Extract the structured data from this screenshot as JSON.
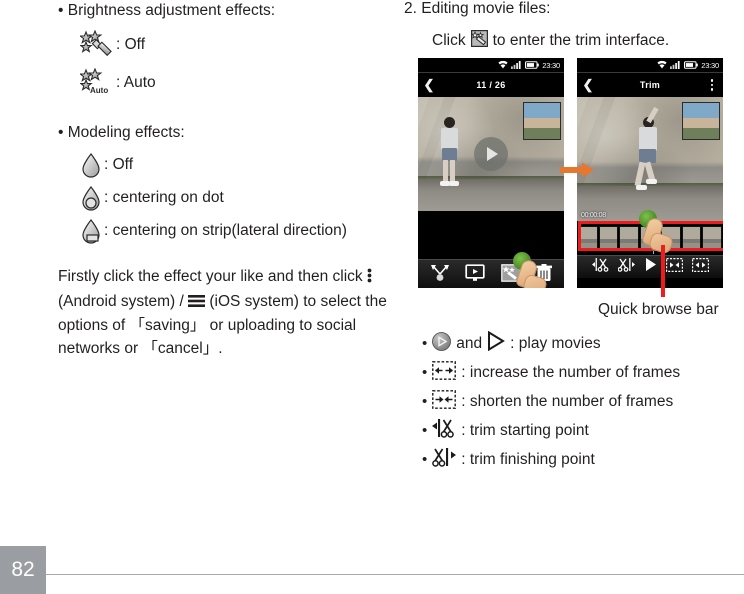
{
  "page": {
    "number": "82"
  },
  "left_column": {
    "brightness_section": {
      "heading": "• Brightness adjustment effects:",
      "items": [
        {
          "icon": "magic-wand-icon",
          "label": ": Off"
        },
        {
          "icon": "magic-wand-auto-icon",
          "label": ": Auto"
        }
      ]
    },
    "modeling_section": {
      "heading": "• Modeling effects:",
      "items": [
        {
          "icon": "teardrop-plain-icon",
          "label": ": Off"
        },
        {
          "icon": "teardrop-dot-icon",
          "label": ": centering on dot"
        },
        {
          "icon": "teardrop-strip-icon",
          "label": ": centering on strip(lateral direction)"
        }
      ]
    },
    "paragraph": {
      "part1": "Firstly click the effect your like and then click ",
      "icon1": "android-overflow-icon",
      "part2": " (Android system) / ",
      "icon2": "ios-menu-icon",
      "part3": " (iOS system) to select the options of 「saving」 or uploading to social networks or 「cancel」."
    }
  },
  "right_column": {
    "heading": "2. Editing movie files:",
    "instruction_before": "Click",
    "instruction_icon": "edit-effects-icon",
    "instruction_after": "to enter the trim interface.",
    "quick_browse_label": "Quick browse bar",
    "bullets": [
      {
        "icons": [
          "play-circle-icon",
          "play-triangle-icon"
        ],
        "conjunction": "and",
        "label": ": play movies"
      },
      {
        "icons": [
          "expand-frames-icon"
        ],
        "label": ": increase the number of frames"
      },
      {
        "icons": [
          "shrink-frames-icon"
        ],
        "label": ": shorten the number of frames"
      },
      {
        "icons": [
          "trim-start-icon"
        ],
        "label": ": trim starting point"
      },
      {
        "icons": [
          "trim-end-icon"
        ],
        "label": ": trim finishing point"
      }
    ]
  },
  "phone_gallery": {
    "status_bar": {
      "time": "23:30",
      "icons": [
        "wifi-icon",
        "signal-icon",
        "battery-icon"
      ]
    },
    "nav": {
      "back_icon": "chevron-left-icon",
      "title": "11 / 26"
    },
    "video": {
      "play_icon": "play-circle-icon"
    },
    "toolbar_icons": [
      "share-icon",
      "slideshow-icon",
      "edit-effects-icon",
      "trash-icon"
    ]
  },
  "phone_trim": {
    "status_bar": {
      "time": "23:30",
      "icons": [
        "wifi-icon",
        "signal-icon",
        "battery-icon"
      ]
    },
    "nav": {
      "back_icon": "chevron-left-icon",
      "title": "Trim",
      "overflow_icon": "android-overflow-icon"
    },
    "timestamp": "00:00:08",
    "filmstrip": {
      "frame_count": 7,
      "selection_highlight_color": "#ee1c1c",
      "playhead_color": "#3fd3e8"
    },
    "toolbar_icons": [
      "trim-start-icon",
      "trim-end-icon",
      "play-triangle-icon",
      "expand-frames-icon",
      "shrink-frames-icon"
    ]
  },
  "colors": {
    "arrow": "#e8762c",
    "highlight_red": "#ee1c1c",
    "footer_gray": "#9a9da2",
    "text": "#231f20"
  }
}
